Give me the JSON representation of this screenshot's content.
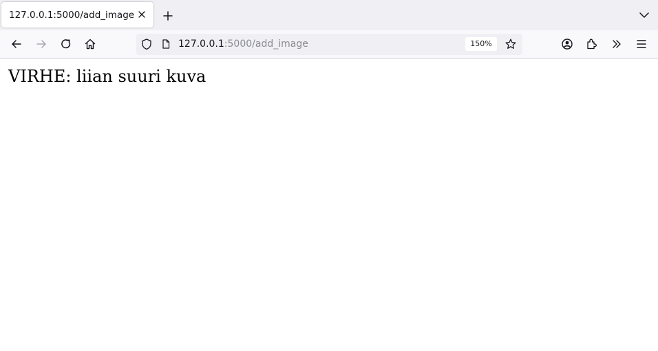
{
  "tab": {
    "title": "127.0.0.1:5000/add_image",
    "close_icon": "close-icon"
  },
  "toolbar": {
    "new_tab_icon": "plus-icon",
    "tab_list_icon": "chevron-down-icon",
    "back_icon": "arrow-left-icon",
    "forward_icon": "arrow-right-icon",
    "reload_icon": "reload-icon",
    "home_icon": "home-icon"
  },
  "urlbar": {
    "host": "127.0.0.1",
    "path": ":5000/add_image",
    "zoom": "150%",
    "shield_icon": "shield-icon",
    "page_icon": "page-icon",
    "bookmark_icon": "star-icon"
  },
  "right_toolbar": {
    "account_icon": "account-icon",
    "extensions_icon": "puzzle-icon",
    "overflow_icon": "double-chevron-icon",
    "menu_icon": "hamburger-icon"
  },
  "page": {
    "message": "VIRHE: liian suuri kuva"
  },
  "colors": {
    "tabstrip_bg": "#f0f0f4",
    "toolbar_bg": "#f9f9fb",
    "url_muted": "#8a8a94",
    "icon": "#15141a"
  }
}
